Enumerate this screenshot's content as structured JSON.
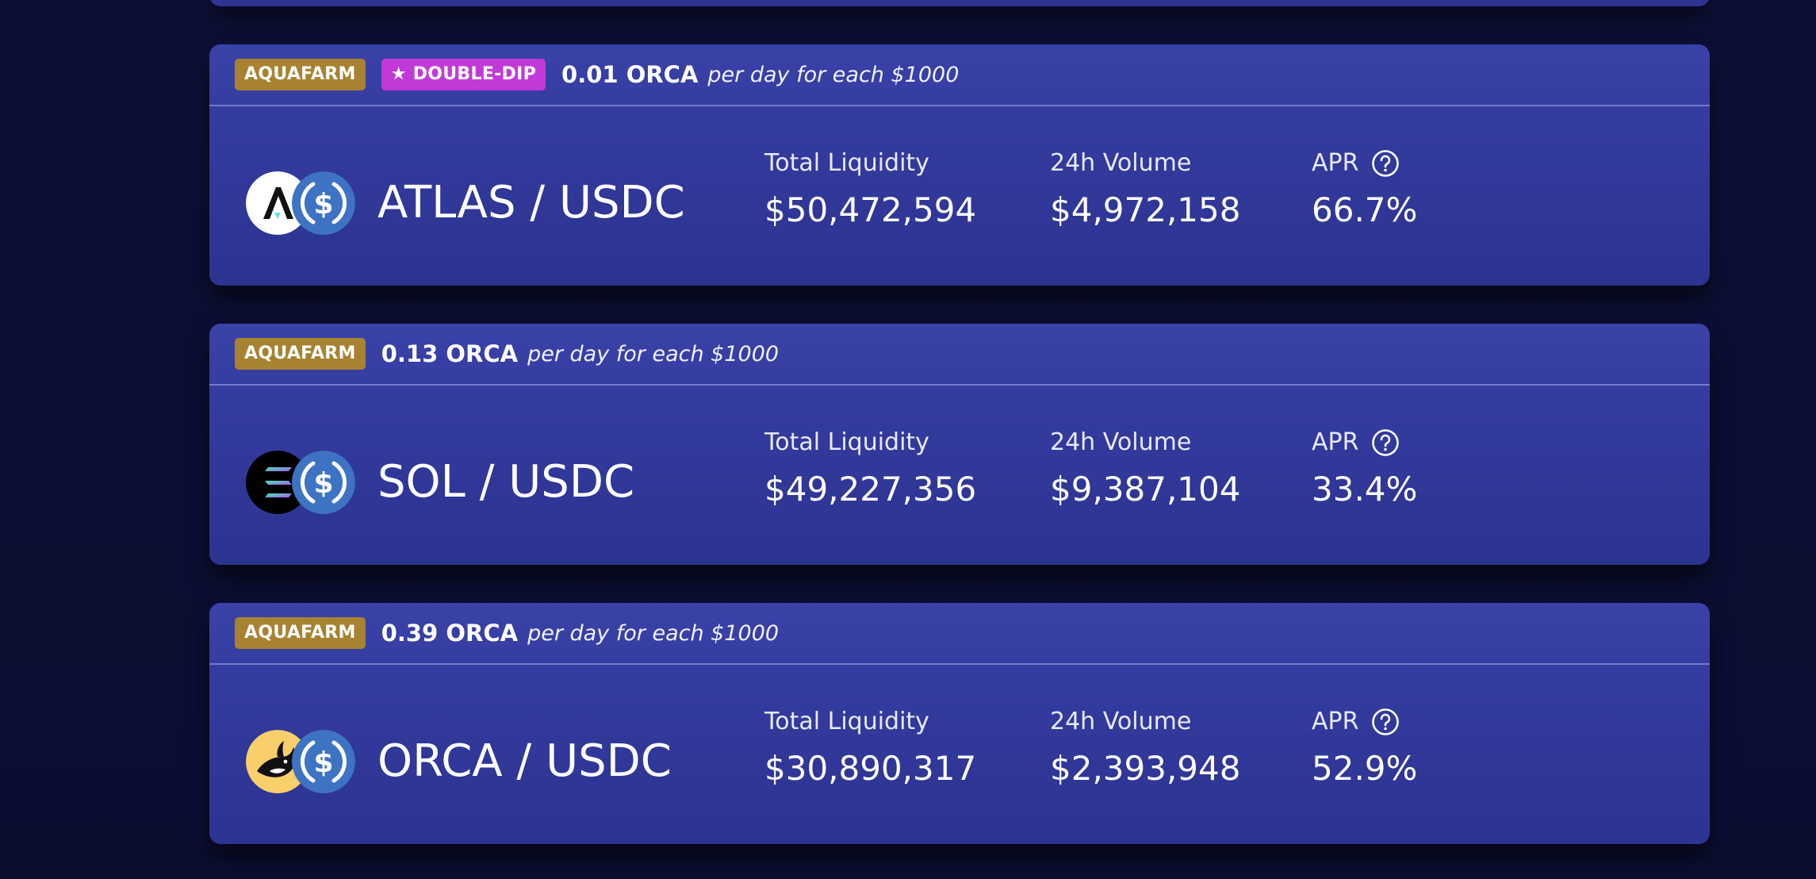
{
  "pools": [
    {
      "badges": [
        {
          "type": "aquafarm",
          "label": "AQUAFARM"
        },
        {
          "type": "doubledip",
          "label": "★ DOUBLE-DIP"
        }
      ],
      "reward_amount": "0.01 ORCA",
      "reward_desc": "per day for each $1000",
      "token_a_icon": "atlas-token-icon",
      "token_b_icon": "usdc-token-icon",
      "pair": "ATLAS / USDC",
      "liquidity_label": "Total Liquidity",
      "liquidity_value": "$50,472,594",
      "volume_label": "24h Volume",
      "volume_value": "$4,972,158",
      "apr_label": "APR",
      "apr_value": "66.7%"
    },
    {
      "badges": [
        {
          "type": "aquafarm",
          "label": "AQUAFARM"
        }
      ],
      "reward_amount": "0.13 ORCA",
      "reward_desc": "per day for each $1000",
      "token_a_icon": "sol-token-icon",
      "token_b_icon": "usdc-token-icon",
      "pair": "SOL / USDC",
      "liquidity_label": "Total Liquidity",
      "liquidity_value": "$49,227,356",
      "volume_label": "24h Volume",
      "volume_value": "$9,387,104",
      "apr_label": "APR",
      "apr_value": "33.4%"
    },
    {
      "badges": [
        {
          "type": "aquafarm",
          "label": "AQUAFARM"
        }
      ],
      "reward_amount": "0.39 ORCA",
      "reward_desc": "per day for each $1000",
      "token_a_icon": "orca-token-icon",
      "token_b_icon": "usdc-token-icon",
      "pair": "ORCA / USDC",
      "liquidity_label": "Total Liquidity",
      "liquidity_value": "$30,890,317",
      "volume_label": "24h Volume",
      "volume_value": "$2,393,948",
      "apr_label": "APR",
      "apr_value": "52.9%"
    }
  ],
  "colors": {
    "background": "#0c0f33",
    "card": "#343b9f",
    "aquafarm_badge": "#a78230",
    "doubledip_badge": "#c13ad8",
    "usdc_blue": "#3e73c4"
  }
}
